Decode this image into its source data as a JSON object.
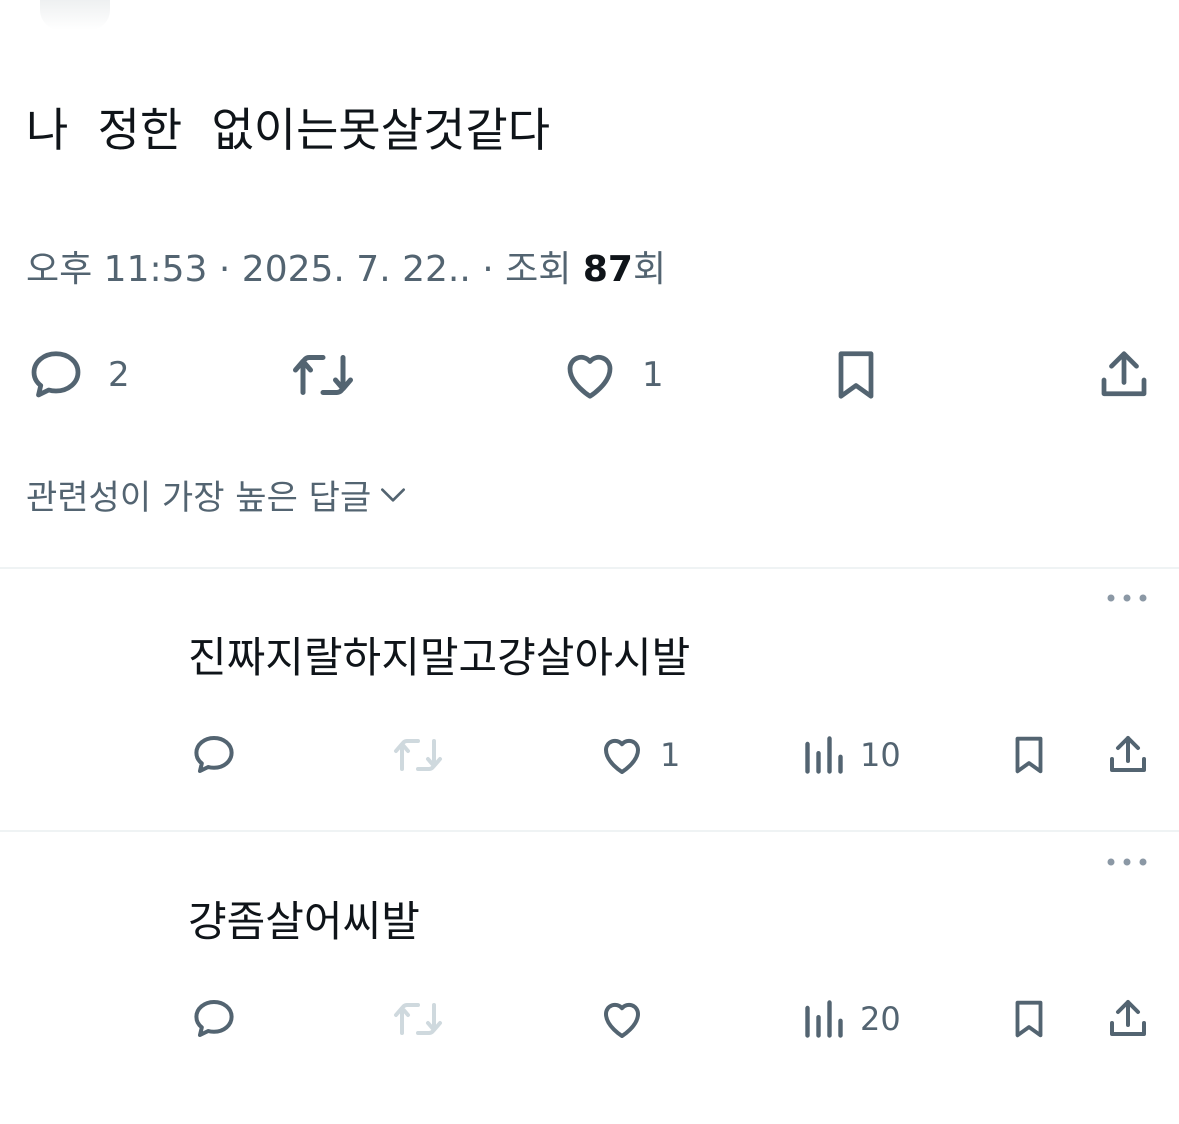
{
  "tweet": {
    "text": "나  정한  없이는못살것같다",
    "time": "오후 11:53",
    "date": "2025. 7. 22.",
    "views_label": "조회",
    "views_count": "87",
    "views_suffix": "회",
    "separator": "·"
  },
  "actions": {
    "reply_count": "2",
    "like_count": "1"
  },
  "sort": {
    "label": "관련성이 가장 높은 답글"
  },
  "replies": [
    {
      "text": "진짜지랄하지말고걍살아시발",
      "like_count": "1",
      "view_count": "10"
    },
    {
      "text": "걍좀살어씨발",
      "like_count": "",
      "view_count": "20"
    }
  ],
  "colors": {
    "text_primary": "#0f1419",
    "text_secondary": "#536471",
    "icon_disabled": "#cfd9de",
    "divider": "#eff3f4"
  },
  "icons": [
    "reply-icon",
    "retweet-icon",
    "like-icon",
    "bookmark-icon",
    "share-icon",
    "views-icon",
    "more-icon",
    "chevron-down-icon"
  ]
}
